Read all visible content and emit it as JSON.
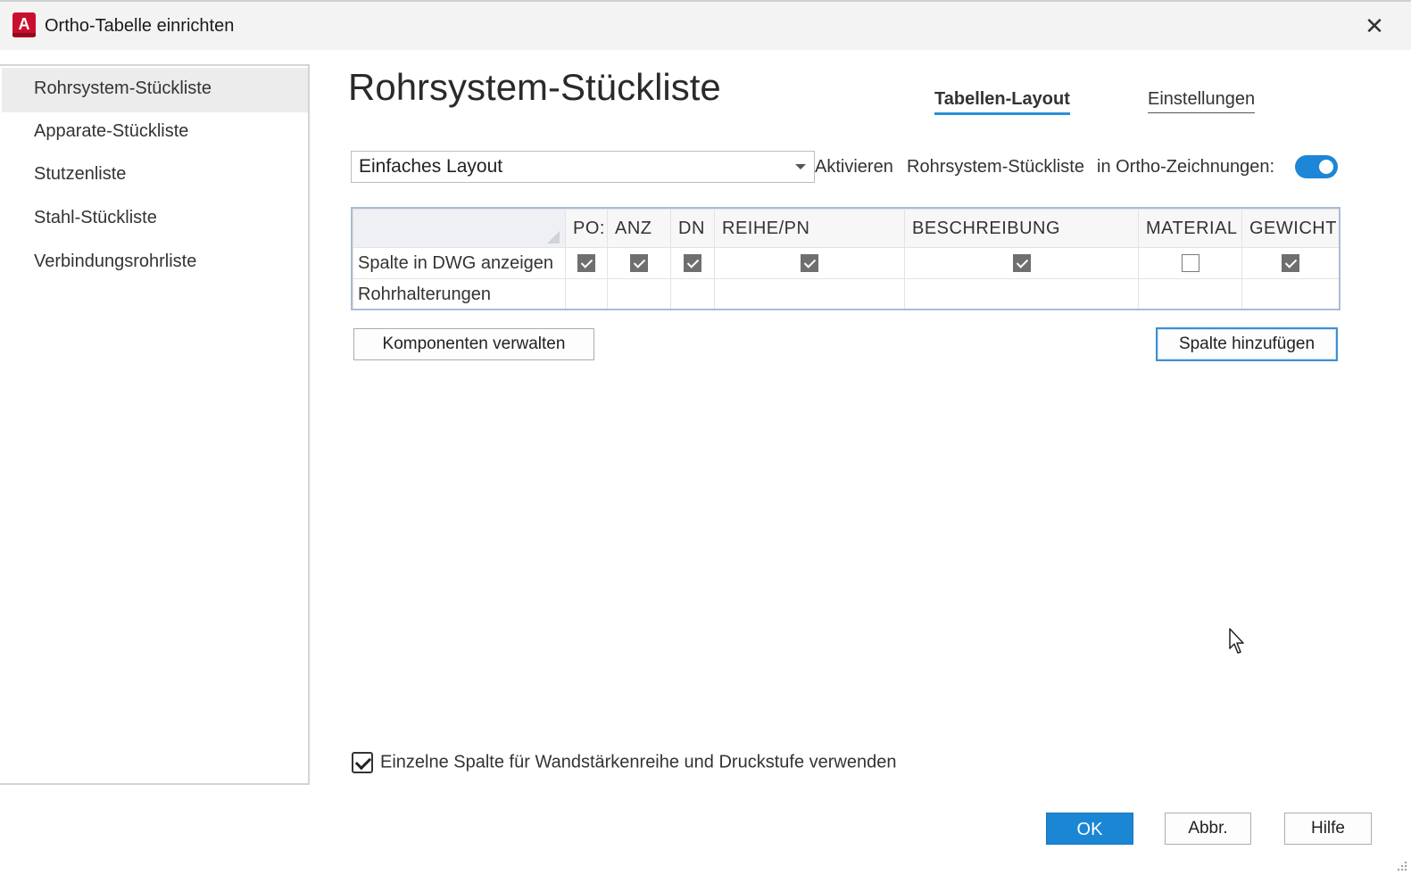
{
  "window": {
    "title": "Ortho-Tabelle einrichten",
    "app_icon_letter": "A"
  },
  "sidebar": {
    "items": [
      {
        "label": "Rohrsystem-Stückliste",
        "active": true
      },
      {
        "label": "Apparate-Stückliste"
      },
      {
        "label": "Stutzenliste"
      },
      {
        "label": "Stahl-Stückliste"
      },
      {
        "label": "Verbindungsrohrliste"
      }
    ]
  },
  "main": {
    "title": "Rohrsystem-Stückliste",
    "tabs": [
      {
        "label": "Tabellen-Layout",
        "active": true
      },
      {
        "label": "Einstellungen"
      }
    ],
    "layout_select": {
      "value": "Einfaches Layout"
    },
    "activate": {
      "word1": "Aktivieren",
      "word2": "Rohrsystem-Stückliste",
      "word3": "in Ortho-Zeichnungen:",
      "enabled": true
    },
    "grid": {
      "columns": [
        "PO:",
        "ANZ",
        "DN",
        "REIHE/PN",
        "BESCHREIBUNG",
        "MATERIAL",
        "GEWICHT"
      ],
      "rows": [
        {
          "label": "Spalte in DWG anzeigen",
          "checks": [
            true,
            true,
            true,
            true,
            true,
            false,
            true
          ]
        },
        {
          "label": "Rohrhalterungen"
        }
      ]
    },
    "buttons": {
      "manage_components": "Komponenten verwalten",
      "add_column": "Spalte hinzufügen"
    },
    "single_column_option": {
      "label": "Einzelne Spalte für Wandstärkenreihe und Druckstufe verwenden",
      "checked": true
    }
  },
  "footer": {
    "ok": "OK",
    "cancel": "Abbr.",
    "help": "Hilfe"
  },
  "colors": {
    "accent": "#1b86d4",
    "tab_underline": "#2b8fd6",
    "brand": "#c8102e"
  }
}
